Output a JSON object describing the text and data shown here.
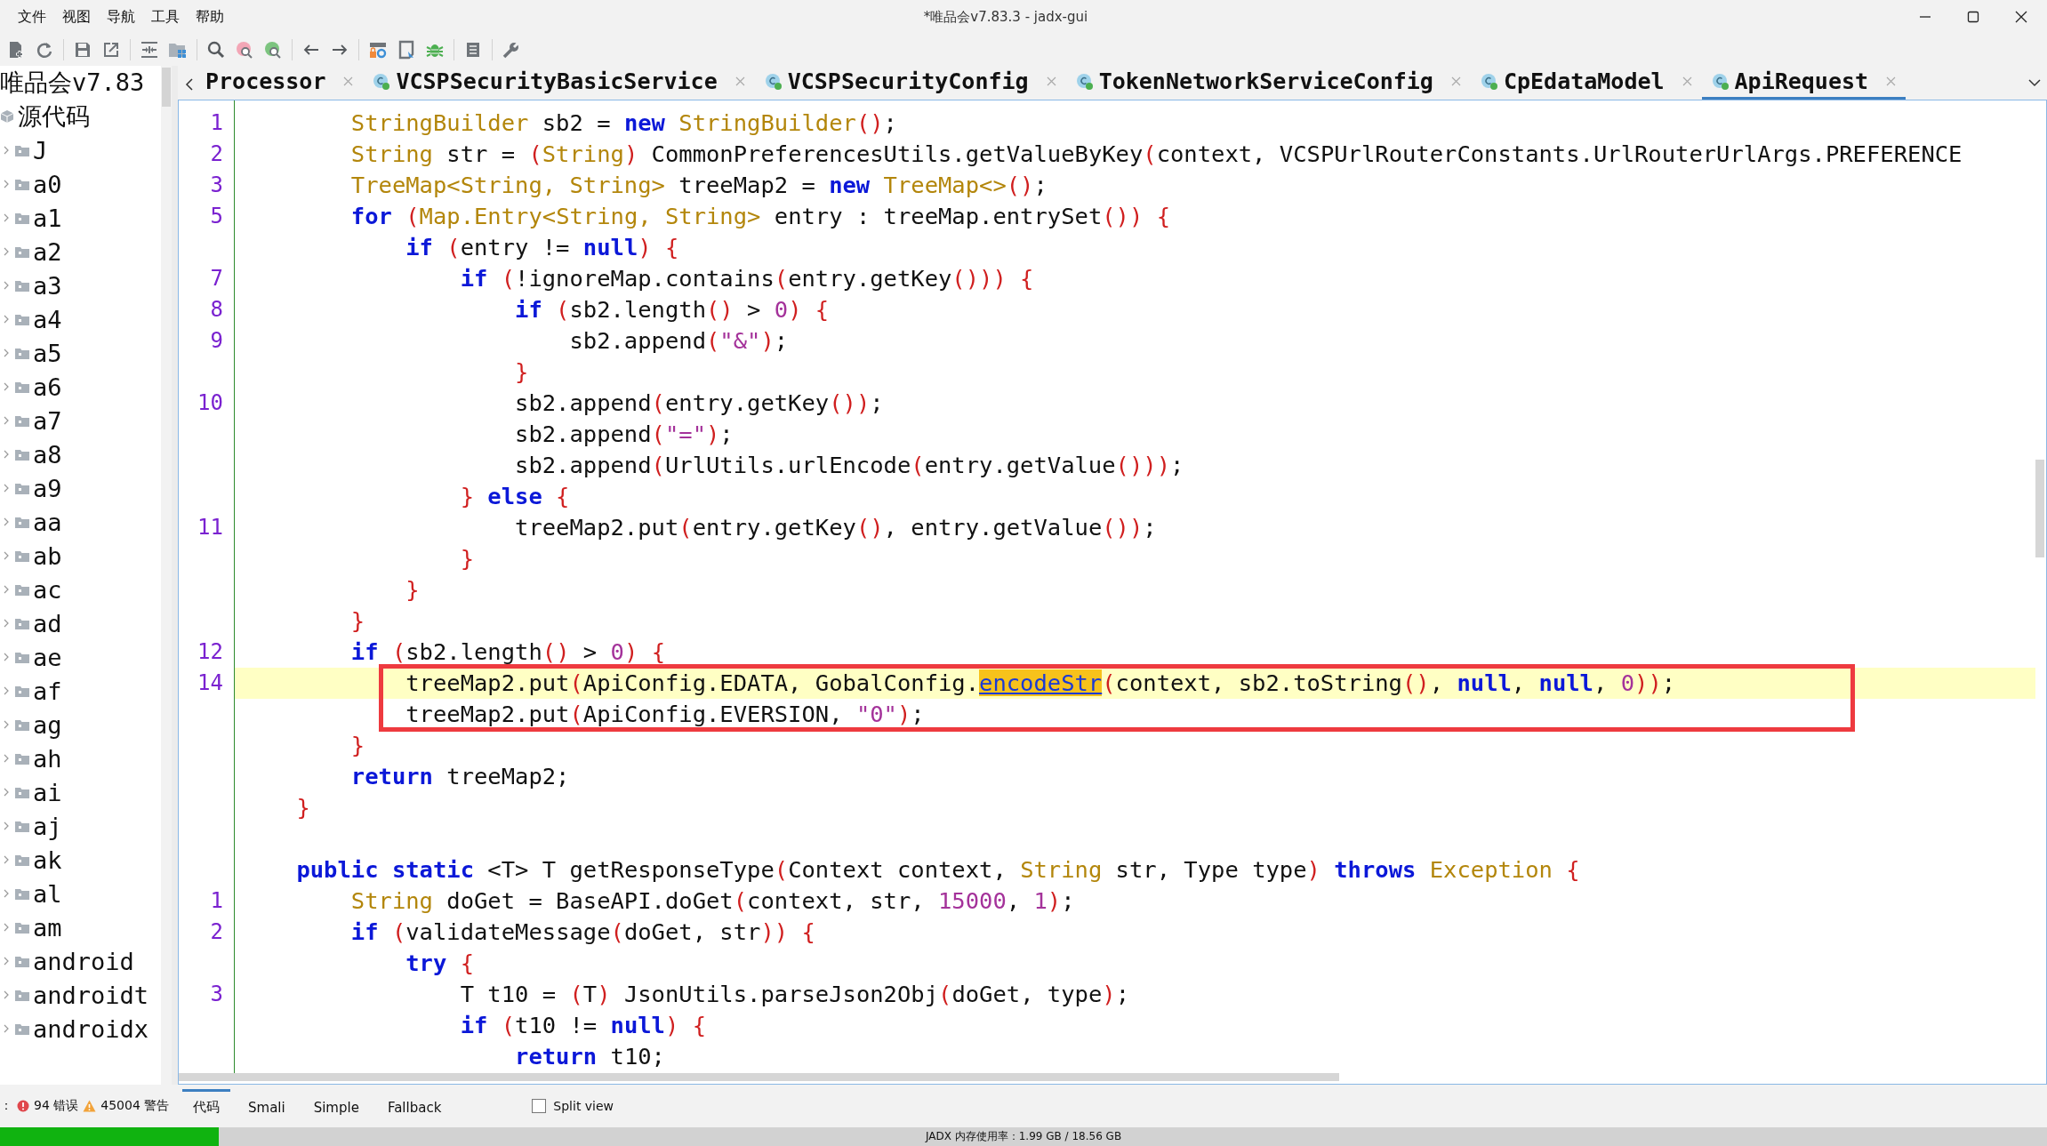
{
  "window": {
    "title": "*唯品会v7.83.3 - jadx-gui"
  },
  "menu": [
    "文件",
    "视图",
    "导航",
    "工具",
    "帮助"
  ],
  "tree": [
    {
      "label": "唯品会v7.83",
      "kind": "project",
      "expanded": true,
      "children": [
        {
          "label": "源代码",
          "kind": "sources",
          "expanded": true,
          "children": [
            {
              "label": "J",
              "kind": "package",
              "expanded": false
            },
            {
              "label": "a0",
              "kind": "package",
              "expanded": false
            },
            {
              "label": "a1",
              "kind": "package",
              "expanded": false
            },
            {
              "label": "a2",
              "kind": "package",
              "expanded": false
            },
            {
              "label": "a3",
              "kind": "package",
              "expanded": false
            },
            {
              "label": "a4",
              "kind": "package",
              "expanded": false
            },
            {
              "label": "a5",
              "kind": "package",
              "expanded": false
            },
            {
              "label": "a6",
              "kind": "package",
              "expanded": false
            },
            {
              "label": "a7",
              "kind": "package",
              "expanded": false
            },
            {
              "label": "a8",
              "kind": "package",
              "expanded": false
            },
            {
              "label": "a9",
              "kind": "package",
              "expanded": false
            },
            {
              "label": "aa",
              "kind": "package",
              "expanded": false
            },
            {
              "label": "ab",
              "kind": "package",
              "expanded": false
            },
            {
              "label": "ac",
              "kind": "package",
              "expanded": false
            },
            {
              "label": "ad",
              "kind": "package",
              "expanded": false
            },
            {
              "label": "ae",
              "kind": "package",
              "expanded": false
            },
            {
              "label": "af",
              "kind": "package",
              "expanded": false
            },
            {
              "label": "ag",
              "kind": "package",
              "expanded": false
            },
            {
              "label": "ah",
              "kind": "package",
              "expanded": false
            },
            {
              "label": "ai",
              "kind": "package",
              "expanded": false
            },
            {
              "label": "aj",
              "kind": "package",
              "expanded": false
            },
            {
              "label": "ak",
              "kind": "package",
              "expanded": false
            },
            {
              "label": "al",
              "kind": "package",
              "expanded": false
            },
            {
              "label": "am",
              "kind": "package",
              "expanded": false
            },
            {
              "label": "android",
              "kind": "package",
              "expanded": false
            },
            {
              "label": "androidt",
              "kind": "package",
              "expanded": false
            },
            {
              "label": "androidx",
              "kind": "package",
              "expanded": false
            }
          ]
        }
      ]
    }
  ],
  "tabs": [
    {
      "label": "Processor",
      "icon": false,
      "selected": false
    },
    {
      "label": "VCSPSecurityBasicService",
      "icon": true,
      "selected": false
    },
    {
      "label": "VCSPSecurityConfig",
      "icon": true,
      "selected": false
    },
    {
      "label": "TokenNetworkServiceConfig",
      "icon": true,
      "selected": false
    },
    {
      "label": "CpEdataModel",
      "icon": true,
      "selected": false
    },
    {
      "label": "ApiRequest",
      "icon": true,
      "selected": true
    }
  ],
  "code": [
    {
      "n": "1",
      "current": false,
      "framed": false,
      "seg": [
        {
          "kind": "type",
          "text": "        StringBuilder"
        },
        {
          "kind": "plain",
          "text": " sb2 = "
        },
        {
          "kind": "keyword",
          "text": "new"
        },
        {
          "kind": "type",
          "text": " StringBuilder"
        },
        {
          "kind": "bracket",
          "text": "()"
        },
        {
          "kind": "plain",
          "text": ";"
        }
      ]
    },
    {
      "n": "2",
      "current": false,
      "framed": false,
      "seg": [
        {
          "kind": "type",
          "text": "        String"
        },
        {
          "kind": "plain",
          "text": " str = "
        },
        {
          "kind": "bracket",
          "text": "("
        },
        {
          "kind": "type",
          "text": "String"
        },
        {
          "kind": "bracket",
          "text": ")"
        },
        {
          "kind": "plain",
          "text": " CommonPreferencesUtils.getValueByKey"
        },
        {
          "kind": "bracket",
          "text": "("
        },
        {
          "kind": "plain",
          "text": "context, VCSPUrlRouterConstants.UrlRouterUrlArgs.PREFERENCE"
        }
      ]
    },
    {
      "n": "3",
      "current": false,
      "framed": false,
      "seg": [
        {
          "kind": "type",
          "text": "        TreeMap<String, String>"
        },
        {
          "kind": "plain",
          "text": " treeMap2 = "
        },
        {
          "kind": "keyword",
          "text": "new"
        },
        {
          "kind": "type",
          "text": " TreeMap<>"
        },
        {
          "kind": "bracket",
          "text": "()"
        },
        {
          "kind": "plain",
          "text": ";"
        }
      ]
    },
    {
      "n": "5",
      "current": false,
      "framed": false,
      "seg": [
        {
          "kind": "keyword",
          "text": "        for"
        },
        {
          "kind": "bracket",
          "text": " ("
        },
        {
          "kind": "type",
          "text": "Map.Entry<String, String>"
        },
        {
          "kind": "plain",
          "text": " entry : treeMap.entrySet"
        },
        {
          "kind": "bracket",
          "text": "()) {"
        }
      ]
    },
    {
      "current": false,
      "framed": false,
      "seg": [
        {
          "kind": "keyword",
          "text": "            if"
        },
        {
          "kind": "bracket",
          "text": " ("
        },
        {
          "kind": "plain",
          "text": "entry != "
        },
        {
          "kind": "keyword",
          "text": "null"
        },
        {
          "kind": "bracket",
          "text": ") {"
        }
      ]
    },
    {
      "n": "7",
      "current": false,
      "framed": false,
      "seg": [
        {
          "kind": "keyword",
          "text": "                if"
        },
        {
          "kind": "bracket",
          "text": " ("
        },
        {
          "kind": "plain",
          "text": "!ignoreMap.contains"
        },
        {
          "kind": "bracket",
          "text": "("
        },
        {
          "kind": "plain",
          "text": "entry.getKey"
        },
        {
          "kind": "bracket",
          "text": "())) {"
        }
      ]
    },
    {
      "n": "8",
      "current": false,
      "framed": false,
      "seg": [
        {
          "kind": "keyword",
          "text": "                    if"
        },
        {
          "kind": "bracket",
          "text": " ("
        },
        {
          "kind": "plain",
          "text": "sb2.length"
        },
        {
          "kind": "bracket",
          "text": "()"
        },
        {
          "kind": "plain",
          "text": " > "
        },
        {
          "kind": "literal",
          "text": "0"
        },
        {
          "kind": "bracket",
          "text": ") {"
        }
      ]
    },
    {
      "n": "9",
      "current": false,
      "framed": false,
      "seg": [
        {
          "kind": "plain",
          "text": "                        sb2.append"
        },
        {
          "kind": "bracket",
          "text": "("
        },
        {
          "kind": "literal",
          "text": "\"&\""
        },
        {
          "kind": "bracket",
          "text": ")"
        },
        {
          "kind": "plain",
          "text": ";"
        }
      ]
    },
    {
      "current": false,
      "framed": false,
      "seg": [
        {
          "kind": "bracket",
          "text": "                    }"
        }
      ]
    },
    {
      "n": "10",
      "current": false,
      "framed": false,
      "seg": [
        {
          "kind": "plain",
          "text": "                    sb2.append"
        },
        {
          "kind": "bracket",
          "text": "("
        },
        {
          "kind": "plain",
          "text": "entry.getKey"
        },
        {
          "kind": "bracket",
          "text": "())"
        },
        {
          "kind": "plain",
          "text": ";"
        }
      ]
    },
    {
      "current": false,
      "framed": false,
      "seg": [
        {
          "kind": "plain",
          "text": "                    sb2.append"
        },
        {
          "kind": "bracket",
          "text": "("
        },
        {
          "kind": "literal",
          "text": "\"=\""
        },
        {
          "kind": "bracket",
          "text": ")"
        },
        {
          "kind": "plain",
          "text": ";"
        }
      ]
    },
    {
      "current": false,
      "framed": false,
      "seg": [
        {
          "kind": "plain",
          "text": "                    sb2.append"
        },
        {
          "kind": "bracket",
          "text": "("
        },
        {
          "kind": "plain",
          "text": "UrlUtils.urlEncode"
        },
        {
          "kind": "bracket",
          "text": "("
        },
        {
          "kind": "plain",
          "text": "entry.getValue"
        },
        {
          "kind": "bracket",
          "text": "()))"
        },
        {
          "kind": "plain",
          "text": ";"
        }
      ]
    },
    {
      "current": false,
      "framed": false,
      "seg": [
        {
          "kind": "bracket",
          "text": "                }"
        },
        {
          "kind": "keyword",
          "text": " else"
        },
        {
          "kind": "bracket",
          "text": " {"
        }
      ]
    },
    {
      "n": "11",
      "current": false,
      "framed": false,
      "seg": [
        {
          "kind": "plain",
          "text": "                    treeMap2.put"
        },
        {
          "kind": "bracket",
          "text": "("
        },
        {
          "kind": "plain",
          "text": "entry.getKey"
        },
        {
          "kind": "bracket",
          "text": "()"
        },
        {
          "kind": "plain",
          "text": ", entry.getValue"
        },
        {
          "kind": "bracket",
          "text": "())"
        },
        {
          "kind": "plain",
          "text": ";"
        }
      ]
    },
    {
      "current": false,
      "framed": false,
      "seg": [
        {
          "kind": "bracket",
          "text": "                }"
        }
      ]
    },
    {
      "current": false,
      "framed": false,
      "seg": [
        {
          "kind": "bracket",
          "text": "            }"
        }
      ]
    },
    {
      "current": false,
      "framed": false,
      "seg": [
        {
          "kind": "bracket",
          "text": "        }"
        }
      ]
    },
    {
      "n": "12",
      "current": false,
      "framed": false,
      "seg": [
        {
          "kind": "keyword",
          "text": "        if"
        },
        {
          "kind": "bracket",
          "text": " ("
        },
        {
          "kind": "plain",
          "text": "sb2.length"
        },
        {
          "kind": "bracket",
          "text": "()"
        },
        {
          "kind": "plain",
          "text": " > "
        },
        {
          "kind": "literal",
          "text": "0"
        },
        {
          "kind": "bracket",
          "text": ") {"
        }
      ]
    },
    {
      "n": "14",
      "current": true,
      "framed": true,
      "seg": [
        {
          "kind": "plain",
          "text": "            treeMap2.put"
        },
        {
          "kind": "bracket",
          "text": "("
        },
        {
          "kind": "plain",
          "text": "ApiConfig.EDATA, GobalConfig."
        },
        {
          "kind": "match",
          "text": "encodeStr"
        },
        {
          "kind": "bracket",
          "text": "("
        },
        {
          "kind": "plain",
          "text": "context, sb2.toString"
        },
        {
          "kind": "bracket",
          "text": "()"
        },
        {
          "kind": "plain",
          "text": ", "
        },
        {
          "kind": "keyword",
          "text": "null"
        },
        {
          "kind": "plain",
          "text": ", "
        },
        {
          "kind": "keyword",
          "text": "null"
        },
        {
          "kind": "plain",
          "text": ", "
        },
        {
          "kind": "literal",
          "text": "0"
        },
        {
          "kind": "bracket",
          "text": "))"
        },
        {
          "kind": "plain",
          "text": ";"
        }
      ]
    },
    {
      "current": false,
      "framed": true,
      "seg": [
        {
          "kind": "plain",
          "text": "            treeMap2.put"
        },
        {
          "kind": "bracket",
          "text": "("
        },
        {
          "kind": "plain",
          "text": "ApiConfig.EVERSION, "
        },
        {
          "kind": "literal",
          "text": "\"0\""
        },
        {
          "kind": "bracket",
          "text": ")"
        },
        {
          "kind": "plain",
          "text": ";"
        }
      ]
    },
    {
      "current": false,
      "framed": false,
      "seg": [
        {
          "kind": "bracket",
          "text": "        }"
        }
      ]
    },
    {
      "current": false,
      "framed": false,
      "seg": [
        {
          "kind": "keyword",
          "text": "        return"
        },
        {
          "kind": "plain",
          "text": " treeMap2;"
        }
      ]
    },
    {
      "current": false,
      "framed": false,
      "seg": [
        {
          "kind": "bracket",
          "text": "    }"
        }
      ]
    },
    {
      "current": false,
      "framed": false
    },
    {
      "current": false,
      "framed": false,
      "seg": [
        {
          "kind": "keyword",
          "text": "    public static"
        },
        {
          "kind": "plain",
          "text": " <T> T getResponseType"
        },
        {
          "kind": "bracket",
          "text": "("
        },
        {
          "kind": "plain",
          "text": "Context context, "
        },
        {
          "kind": "type",
          "text": "String"
        },
        {
          "kind": "plain",
          "text": " str, Type type"
        },
        {
          "kind": "bracket",
          "text": ")"
        },
        {
          "kind": "keyword",
          "text": " throws"
        },
        {
          "kind": "type",
          "text": " Exception"
        },
        {
          "kind": "bracket",
          "text": " {"
        }
      ]
    },
    {
      "n": "1",
      "current": false,
      "framed": false,
      "seg": [
        {
          "kind": "type",
          "text": "        String"
        },
        {
          "kind": "plain",
          "text": " doGet = BaseAPI.doGet"
        },
        {
          "kind": "bracket",
          "text": "("
        },
        {
          "kind": "plain",
          "text": "context, str, "
        },
        {
          "kind": "literal",
          "text": "15000"
        },
        {
          "kind": "plain",
          "text": ", "
        },
        {
          "kind": "literal",
          "text": "1"
        },
        {
          "kind": "bracket",
          "text": ")"
        },
        {
          "kind": "plain",
          "text": ";"
        }
      ]
    },
    {
      "n": "2",
      "current": false,
      "framed": false,
      "seg": [
        {
          "kind": "keyword",
          "text": "        if"
        },
        {
          "kind": "bracket",
          "text": " ("
        },
        {
          "kind": "plain",
          "text": "validateMessage"
        },
        {
          "kind": "bracket",
          "text": "("
        },
        {
          "kind": "plain",
          "text": "doGet, str"
        },
        {
          "kind": "bracket",
          "text": ")) {"
        }
      ]
    },
    {
      "current": false,
      "framed": false,
      "seg": [
        {
          "kind": "keyword",
          "text": "            try"
        },
        {
          "kind": "bracket",
          "text": " {"
        }
      ]
    },
    {
      "n": "3",
      "current": false,
      "framed": false,
      "seg": [
        {
          "kind": "plain",
          "text": "                T t10 = "
        },
        {
          "kind": "bracket",
          "text": "("
        },
        {
          "kind": "plain",
          "text": "T"
        },
        {
          "kind": "bracket",
          "text": ")"
        },
        {
          "kind": "plain",
          "text": " JsonUtils.parseJson2Obj"
        },
        {
          "kind": "bracket",
          "text": "("
        },
        {
          "kind": "plain",
          "text": "doGet, type"
        },
        {
          "kind": "bracket",
          "text": ")"
        },
        {
          "kind": "plain",
          "text": ";"
        }
      ]
    },
    {
      "current": false,
      "framed": false,
      "seg": [
        {
          "kind": "keyword",
          "text": "                if"
        },
        {
          "kind": "bracket",
          "text": " ("
        },
        {
          "kind": "plain",
          "text": "t10 != "
        },
        {
          "kind": "keyword",
          "text": "null"
        },
        {
          "kind": "bracket",
          "text": ") {"
        }
      ]
    },
    {
      "current": false,
      "framed": false,
      "seg": [
        {
          "kind": "keyword",
          "text": "                    return"
        },
        {
          "kind": "plain",
          "text": " t10;"
        }
      ]
    }
  ],
  "issues": {
    "prefix": "：",
    "errors": "94 错误",
    "warnings": "45004 警告"
  },
  "view_tabs": [
    {
      "label": "代码",
      "selected": true
    },
    {
      "label": "Smali",
      "selected": false
    },
    {
      "label": "Simple",
      "selected": false
    },
    {
      "label": "Fallback",
      "selected": false
    }
  ],
  "split_view": {
    "label": "Split view",
    "checked": false
  },
  "memory": {
    "label": "JADX 内存使用率：1.99 GB / 18.56 GB",
    "level": 0.107
  }
}
